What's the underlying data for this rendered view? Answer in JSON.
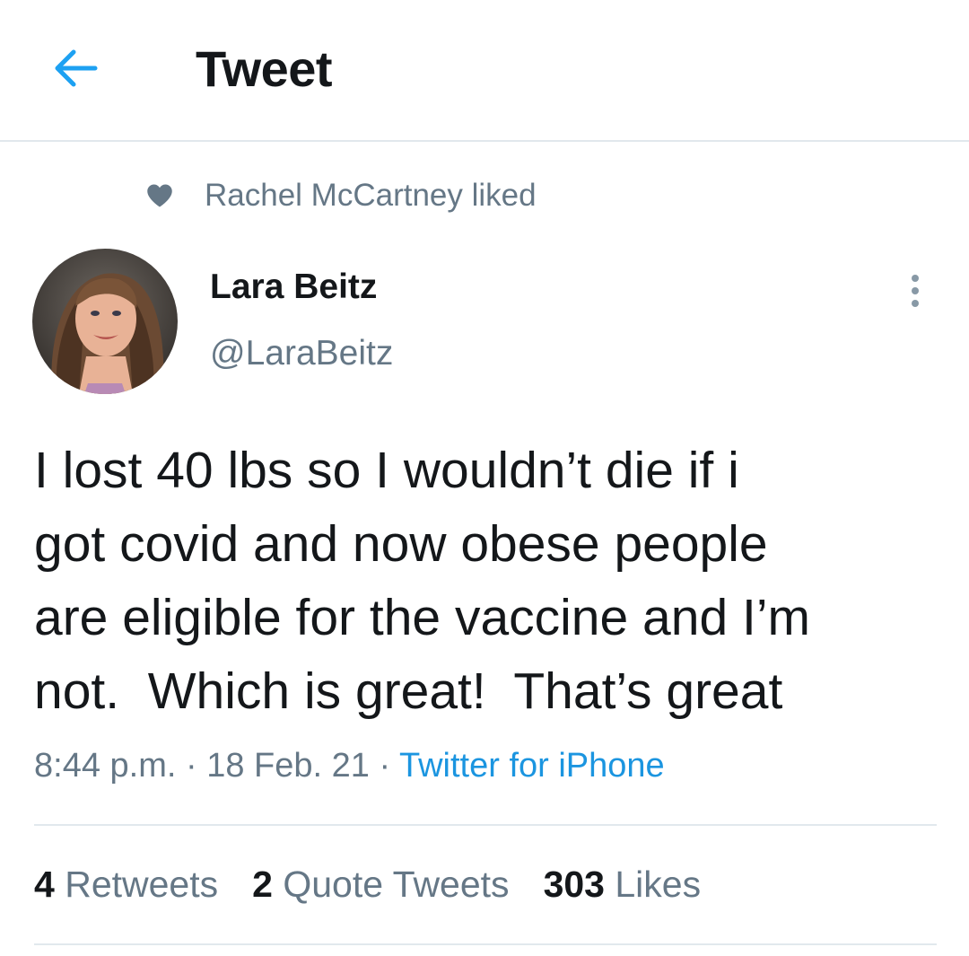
{
  "header": {
    "title": "Tweet",
    "back_icon": "arrow-left-icon",
    "accent_color": "#1da1f2"
  },
  "social_context": {
    "icon": "heart-icon",
    "text": "Rachel McCartney liked"
  },
  "tweet": {
    "author": {
      "name": "Lara Beitz",
      "handle": "@LaraBeitz",
      "avatar_alt": "Lara Beitz"
    },
    "more_icon": "more-vertical-icon",
    "text": "I lost 40 lbs so I wouldn’t die if i\ngot covid and now obese people\nare eligible for the vaccine and I’m\nnot.  Which is great!  That’s great",
    "time": "8:44 p.m.",
    "sep1": " · ",
    "date": "18 Feb. 21",
    "sep2": " · ",
    "source": "Twitter for iPhone"
  },
  "stats": {
    "retweets_count": "4",
    "retweets_label": " Retweets",
    "quotes_count": "2",
    "quotes_label": " Quote Tweets",
    "likes_count": "303",
    "likes_label": " Likes"
  },
  "colors": {
    "primary_text": "#14171a",
    "secondary_text": "#657786",
    "link": "#1b95e0",
    "divider": "#e1e8ed"
  }
}
